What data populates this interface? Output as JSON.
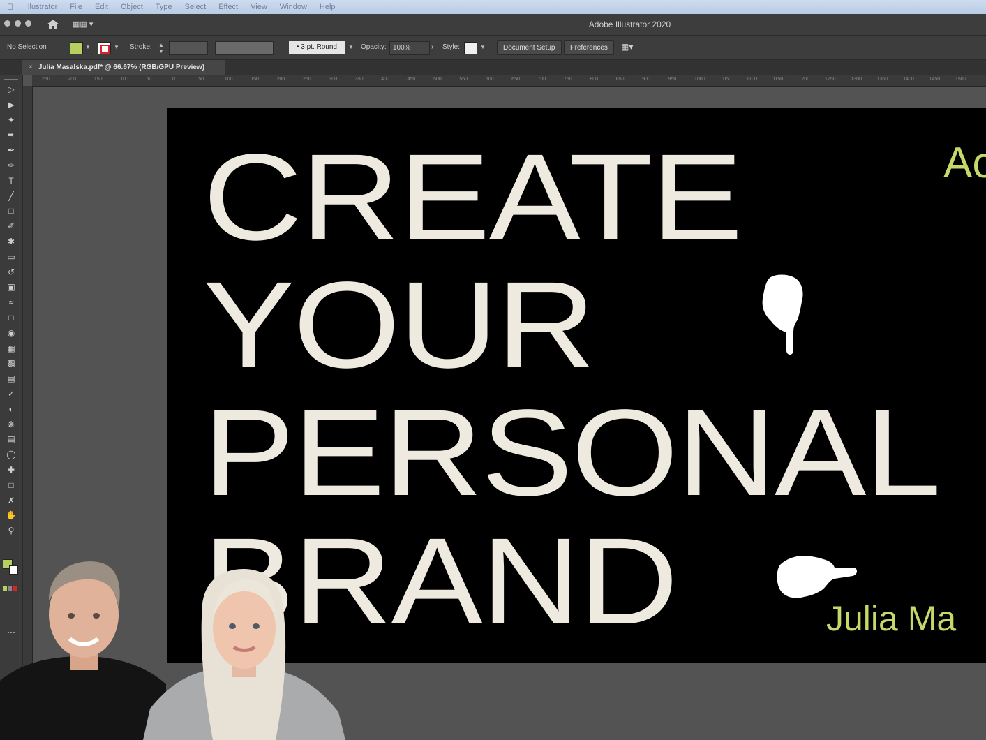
{
  "menubar": {
    "items": [
      "Illustrator",
      "File",
      "Edit",
      "Object",
      "Type",
      "Select",
      "Effect",
      "View",
      "Window",
      "Help"
    ]
  },
  "window": {
    "title": "Adobe Illustrator 2020"
  },
  "control_bar": {
    "selection": "No Selection",
    "fill_color": "#b7cf5f",
    "stroke_label": "Stroke:",
    "brush": "3 pt. Round",
    "opacity_label": "Opacity:",
    "opacity_value": "100%",
    "style_label": "Style:",
    "document_setup": "Document Setup",
    "preferences": "Preferences"
  },
  "document_tab": {
    "close": "×",
    "title": "Julia Masalska.pdf* @ 66.67% (RGB/GPU Preview)"
  },
  "ruler": {
    "ticks": [
      "250",
      "200",
      "150",
      "100",
      "50",
      "0",
      "50",
      "100",
      "150",
      "200",
      "250",
      "300",
      "350",
      "400",
      "450",
      "500",
      "550",
      "600",
      "650",
      "700",
      "750",
      "800",
      "850",
      "900",
      "950",
      "1000",
      "1050",
      "1100",
      "1150",
      "1200",
      "1250",
      "1300",
      "1350",
      "1400",
      "1450",
      "1500"
    ]
  },
  "toolbar": {
    "tools": [
      "selection-icon",
      "direct-selection-icon",
      "magic-wand-icon",
      "lasso-icon",
      "pen-icon",
      "curvature-icon",
      "type-icon",
      "line-icon",
      "rectangle-icon",
      "paintbrush-icon",
      "shaper-icon",
      "eraser-icon",
      "rotate-icon",
      "scale-icon",
      "width-icon",
      "free-transform-icon",
      "shape-builder-icon",
      "perspective-icon",
      "mesh-icon",
      "gradient-icon",
      "eyedropper-icon",
      "blend-icon",
      "symbol-sprayer-icon",
      "column-graph-icon",
      "ellipse-icon",
      "slice-icon",
      "artboard-icon",
      "knife-icon",
      "hand-icon",
      "zoom-icon"
    ]
  },
  "artboard": {
    "lines": [
      "CREATE",
      "YOUR",
      "PERSONAL",
      "BRAND"
    ],
    "corner_text": "Ac",
    "author_text": "Julia Ma",
    "text_color": "#efeae0",
    "accent_color": "#c5d96a"
  }
}
